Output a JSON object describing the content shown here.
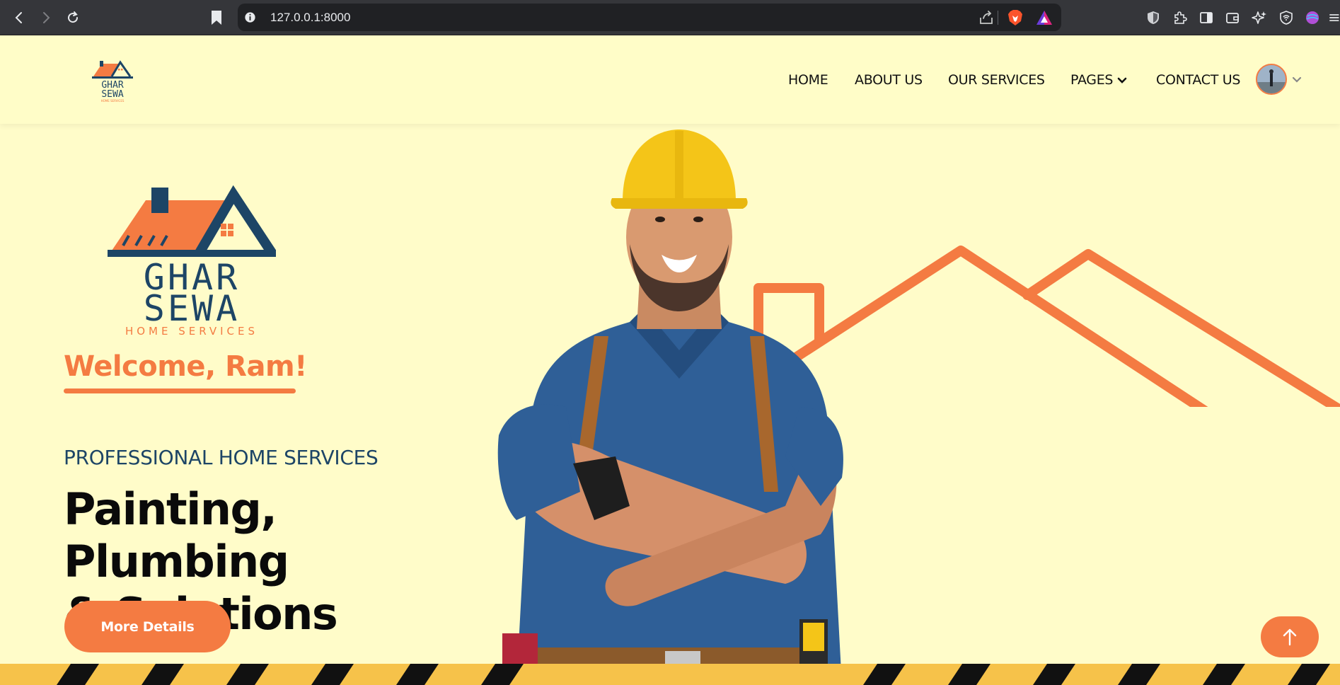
{
  "browser": {
    "url": "127.0.0.1:8000",
    "icons": [
      "back-icon",
      "forward-icon",
      "reload-icon",
      "bookmark-icon",
      "site-info-icon",
      "share-icon",
      "brave-shields-icon",
      "brave-rewards-icon",
      "shield-extension-icon",
      "extensions-icon",
      "sidebar-icon",
      "wallet-icon",
      "leo-ai-icon",
      "vpn-icon",
      "profile-icon",
      "menu-icon"
    ]
  },
  "header": {
    "logo": {
      "line1": "GHAR",
      "line2": "SEWA",
      "tagline": "HOME SERVICES"
    },
    "nav": [
      {
        "label": "HOME"
      },
      {
        "label": "ABOUT US"
      },
      {
        "label": "OUR SERVICES"
      },
      {
        "label": "PAGES"
      },
      {
        "label": "CONTACT US"
      }
    ]
  },
  "hero": {
    "logo": {
      "line1": "GHAR",
      "line2": "SEWA",
      "tagline": "HOME SERVICES"
    },
    "welcome": "Welcome, Ram!",
    "subheading": "PROFESSIONAL HOME SERVICES",
    "headline_line1": "Painting, Plumbing",
    "headline_line2": "& Solutions",
    "cta_label": "More Details"
  },
  "colors": {
    "accent": "#f47b42",
    "navy": "#1d4566",
    "background": "#fffcc9",
    "hazard_yellow": "#f6c24a"
  }
}
